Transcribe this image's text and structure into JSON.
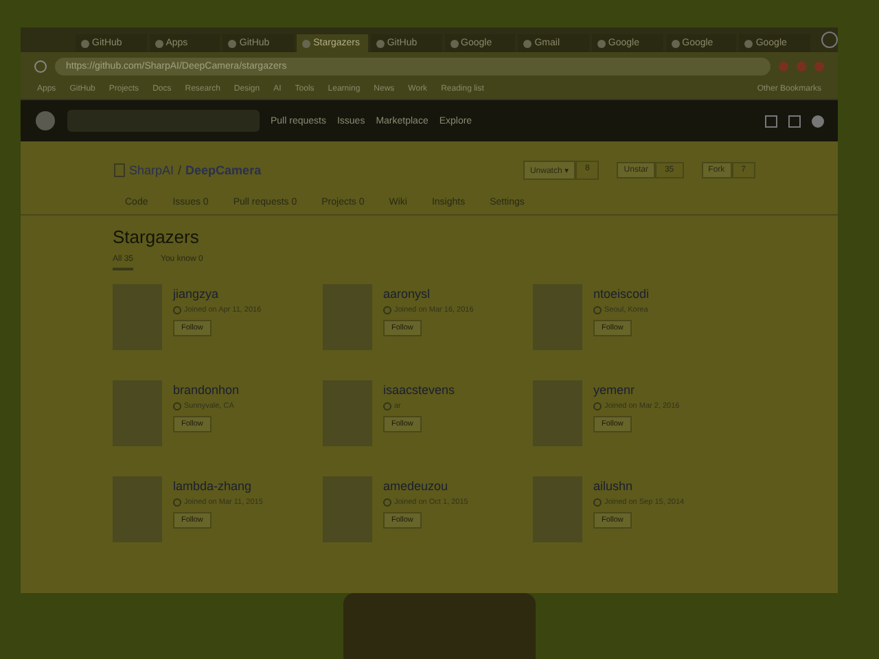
{
  "browser": {
    "tabs": [
      {
        "label": "GitHub",
        "selected": false
      },
      {
        "label": "Apps",
        "selected": false
      },
      {
        "label": "GitHub",
        "selected": false
      },
      {
        "label": "Stargazers",
        "selected": true
      },
      {
        "label": "GitHub",
        "selected": false
      },
      {
        "label": "Google",
        "selected": false
      },
      {
        "label": "Gmail",
        "selected": false
      },
      {
        "label": "Google",
        "selected": false
      },
      {
        "label": "Google",
        "selected": false
      },
      {
        "label": "Google",
        "selected": false
      }
    ],
    "url": "https://github.com/SharpAI/DeepCamera/stargazers",
    "bookmarks": [
      "Apps",
      "GitHub",
      "Projects",
      "Docs",
      "Research",
      "Design",
      "AI",
      "Tools",
      "Learning",
      "News",
      "Work",
      "Reading list"
    ],
    "other_bookmarks": "Other Bookmarks"
  },
  "github": {
    "nav": [
      "Pull requests",
      "Issues",
      "Marketplace",
      "Explore"
    ],
    "repo": {
      "owner": "SharpAI",
      "separator": "/",
      "name": "DeepCamera"
    },
    "actions": [
      {
        "label": "Unwatch ▾",
        "count": "8"
      },
      {
        "label": "Unstar",
        "count": "35"
      },
      {
        "label": "Fork",
        "count": "7"
      }
    ],
    "repo_tabs": [
      {
        "label": "Code",
        "selected": false
      },
      {
        "label": "Issues",
        "count": "0",
        "selected": false
      },
      {
        "label": "Pull requests",
        "count": "0",
        "selected": false
      },
      {
        "label": "Projects",
        "count": "0",
        "selected": false
      },
      {
        "label": "Wiki",
        "selected": false
      },
      {
        "label": "Insights",
        "selected": false
      },
      {
        "label": "Settings",
        "selected": false
      }
    ],
    "heading": "Stargazers",
    "filters": [
      {
        "label": "All",
        "count": "35",
        "selected": true
      },
      {
        "label": "You know",
        "count": "0",
        "selected": false
      }
    ],
    "users": [
      {
        "name": "jiangzya",
        "detail": "Joined on Apr 11, 2016",
        "button": "Follow"
      },
      {
        "name": "aaronysl",
        "detail": "Joined on Mar 16, 2016",
        "button": "Follow"
      },
      {
        "name": "ntoeiscodi",
        "detail": "Seoul, Korea",
        "button": "Follow"
      },
      {
        "name": "brandonhon",
        "detail": "Sunnyvale, CA",
        "button": "Follow"
      },
      {
        "name": "isaacstevens",
        "detail": "ar",
        "button": "Follow"
      },
      {
        "name": "yemenr",
        "detail": "Joined on Mar 2, 2016",
        "button": "Follow"
      },
      {
        "name": "lambda-zhang",
        "detail": "Joined on Mar 11, 2015",
        "button": "Follow"
      },
      {
        "name": "amedeuzou",
        "detail": "Joined on Oct 1, 2015",
        "button": "Follow"
      },
      {
        "name": "ailushn",
        "detail": "Joined on Sep 15, 2014",
        "button": "Follow"
      }
    ]
  }
}
